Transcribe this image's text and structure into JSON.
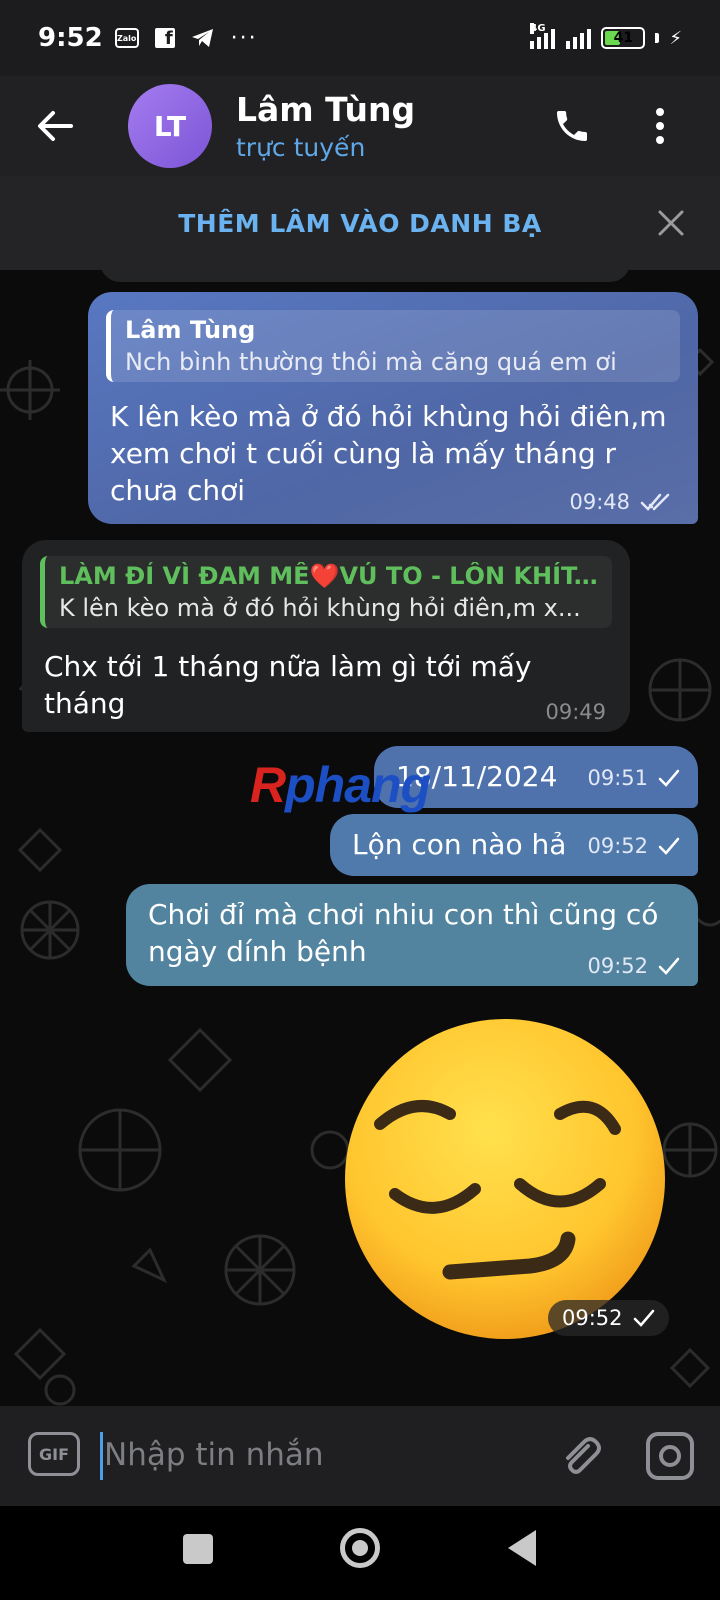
{
  "status_bar": {
    "time": "9:52",
    "zalo_label": "Zalo",
    "network": "4G",
    "battery": "41",
    "battery_level": 0.41,
    "icons": [
      "zalo-icon",
      "facebook-icon",
      "telegram-icon",
      "more-dots-icon",
      "signal-icon",
      "battery-icon",
      "charging-icon"
    ]
  },
  "header": {
    "avatar_initials": "LT",
    "contact_name": "Lâm Tùng",
    "contact_status": "trực tuyến",
    "icons": [
      "back-arrow-icon",
      "phone-icon",
      "more-vertical-icon"
    ]
  },
  "banner": {
    "add_contact_label": "THÊM LÂM VÀO DANH BẠ"
  },
  "messages": [
    {
      "direction": "out",
      "reply_name": "Lâm Tùng",
      "reply_text": "Nch bình thường thôi mà căng quá em ơi",
      "text": "K lên kèo mà ở đó hỏi khùng hỏi điên,m xem chơi t cuối cùng là mấy tháng r chưa chơi",
      "time": "09:48",
      "status": "read"
    },
    {
      "direction": "in",
      "reply_name": "LÀM ĐỈ VÌ ĐAM MÊ❤️VÚ TO - LỒN KHÍT...",
      "reply_text": "K lên kèo mà ở đó hỏi khùng hỏi điên,m x...",
      "text": "Chx tới 1 tháng nữa làm gì tới mấy tháng",
      "time": "09:49"
    },
    {
      "direction": "out",
      "text": "18/11/2024",
      "time": "09:51",
      "status": "sent"
    },
    {
      "direction": "out",
      "text": "Lộn con nào hả",
      "time": "09:52",
      "status": "sent"
    },
    {
      "direction": "out",
      "text": "Chơi đỉ mà chơi nhiu con thì cũng có ngày dính bệnh",
      "time": "09:52",
      "status": "sent"
    },
    {
      "direction": "out",
      "type": "emoji",
      "emoji_name": "pensive-face-emoji",
      "time": "09:52",
      "status": "sent"
    }
  ],
  "watermark": {
    "first": "R",
    "rest": "phang"
  },
  "input_bar": {
    "gif_label": "GIF",
    "placeholder": "Nhập tin nhắn",
    "icons": [
      "gif-icon",
      "attach-icon",
      "camera-icon"
    ]
  },
  "nav_bar": {
    "icons": [
      "recents-icon",
      "home-icon",
      "back-icon"
    ]
  },
  "colors": {
    "accent": "#5fa8e8",
    "outgoing_bubble": "#5070b0",
    "incoming_bubble": "#212224",
    "reply_accent_in": "#5fbf5c",
    "watermark_red": "#d9231f",
    "watermark_blue": "#1d4fc4"
  }
}
